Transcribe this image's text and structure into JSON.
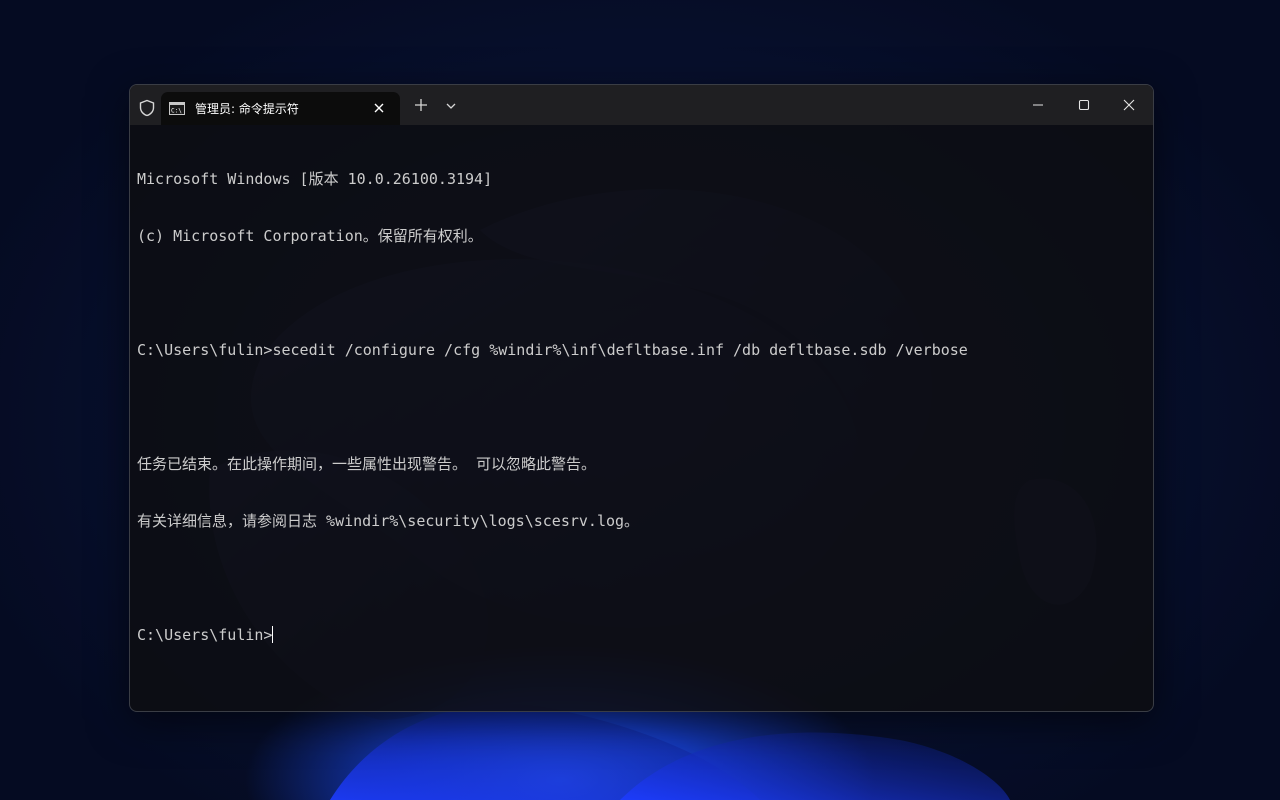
{
  "window": {
    "tab_title": "管理员: 命令提示符",
    "icons": {
      "shield": "shield-icon",
      "tab": "cmd-icon",
      "tab_close": "close-icon",
      "new_tab": "plus-icon",
      "dropdown": "chevron-down-icon",
      "minimize": "minimize-icon",
      "maximize": "maximize-icon",
      "close": "close-icon"
    },
    "colors": {
      "titlebar": "#1f1f22",
      "tab": "#0c0c0c",
      "terminal_text": "#cccccc",
      "wallpaper_accent": "#2a5cff"
    }
  },
  "terminal": {
    "lines": [
      "Microsoft Windows [版本 10.0.26100.3194]",
      "(c) Microsoft Corporation。保留所有权利。",
      "",
      "C:\\Users\\fulin>secedit /configure /cfg %windir%\\inf\\defltbase.inf /db defltbase.sdb /verbose",
      "",
      "任务已结束。在此操作期间，一些属性出现警告。 可以忽略此警告。",
      "有关详细信息，请参阅日志 %windir%\\security\\logs\\scesrv.log。",
      ""
    ],
    "prompt": "C:\\Users\\fulin>"
  }
}
